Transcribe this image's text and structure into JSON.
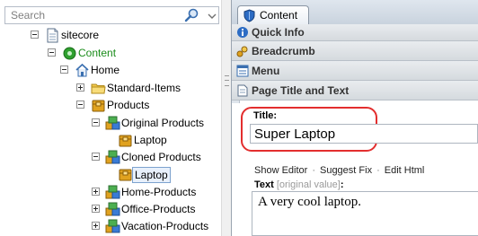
{
  "search": {
    "placeholder": "Search"
  },
  "tree": {
    "items": [
      {
        "label": "sitecore",
        "icon": "page-icon",
        "expander": "minus"
      },
      {
        "label": "Content",
        "icon": "content-icon",
        "expander": "minus",
        "color": "#1a8c1a"
      },
      {
        "label": "Home",
        "icon": "home-icon",
        "expander": "minus"
      },
      {
        "label": "Standard-Items",
        "icon": "folder-icon",
        "expander": "plus"
      },
      {
        "label": "Products",
        "icon": "products-icon",
        "expander": "minus"
      },
      {
        "label": "Original Products",
        "icon": "products-group-icon",
        "expander": "minus"
      },
      {
        "label": "Laptop",
        "icon": "laptop-item-icon",
        "expander": "none"
      },
      {
        "label": "Cloned Products",
        "icon": "products-group-icon",
        "expander": "minus"
      },
      {
        "label": "Laptop",
        "icon": "laptop-item-icon",
        "expander": "none",
        "selected": true
      },
      {
        "label": "Home-Products",
        "icon": "products-group-icon",
        "expander": "plus"
      },
      {
        "label": "Office-Products",
        "icon": "products-group-icon",
        "expander": "plus"
      },
      {
        "label": "Vacation-Products",
        "icon": "products-group-icon",
        "expander": "plus"
      }
    ]
  },
  "editor": {
    "tab_label": "Content",
    "sections": [
      {
        "label": "Quick Info",
        "icon": "info-icon"
      },
      {
        "label": "Breadcrumb",
        "icon": "breadcrumb-icon"
      },
      {
        "label": "Menu",
        "icon": "menu-icon"
      },
      {
        "label": "Page Title and Text",
        "icon": "page-icon"
      }
    ],
    "title_field": {
      "label": "Title:",
      "value": "Super Laptop"
    },
    "toolbar": {
      "show_editor": "Show Editor",
      "suggest_fix": "Suggest Fix",
      "edit_html": "Edit Html",
      "separator": "·"
    },
    "text_field": {
      "label": "Text",
      "original": "[original value]",
      "colon": ":",
      "value": "A very cool laptop."
    }
  },
  "colors": {
    "highlight_ring": "#e32e2e",
    "content_node": "#1a8c1a",
    "selection_border": "#7da2ce"
  }
}
